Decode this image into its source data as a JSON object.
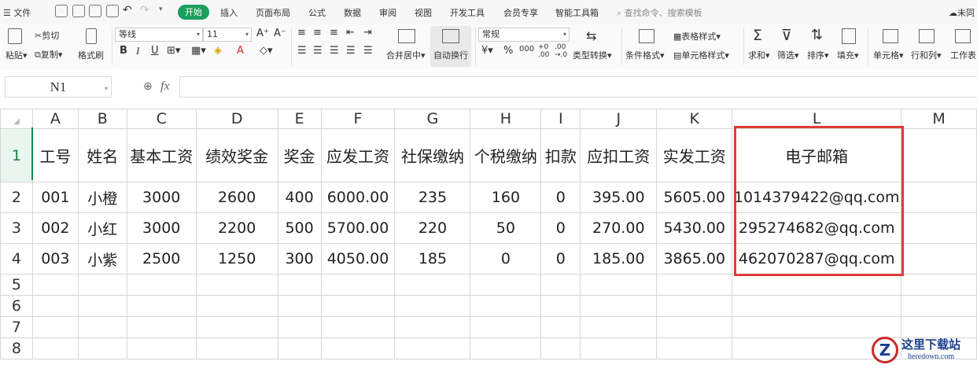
{
  "menu": {
    "file": "文件",
    "tabs": [
      "开始",
      "插入",
      "页面布局",
      "公式",
      "数据",
      "审阅",
      "视图",
      "开发工具",
      "会员专享",
      "智能工具箱"
    ],
    "search": "查找命令、搜索模板",
    "cloud": "未同"
  },
  "ribbon": {
    "paste": "粘贴",
    "cut": "剪切",
    "copy": "复制",
    "format_painter": "格式刷",
    "font_name": "等线",
    "font_size": "11",
    "merge_center": "合并居中",
    "wrap_text": "自动换行",
    "number_format": "常规",
    "type_convert": "类型转换",
    "conditional_format": "条件格式",
    "table_style": "表格样式",
    "cell_style": "单元格样式",
    "sum": "求和",
    "filter": "筛选",
    "sort": "排序",
    "fill": "填充",
    "cell": "单元格",
    "row_col": "行和列",
    "worksheet": "工作表"
  },
  "formula_bar": {
    "name_box": "N1",
    "fx": "fx",
    "value": ""
  },
  "sheet": {
    "columns": [
      "A",
      "B",
      "C",
      "D",
      "E",
      "F",
      "G",
      "H",
      "I",
      "J",
      "K",
      "L",
      "M"
    ],
    "rows": [
      "1",
      "2",
      "3",
      "4",
      "5",
      "6",
      "7",
      "8"
    ],
    "headers": [
      "工号",
      "姓名",
      "基本工资",
      "绩效奖金",
      "奖金",
      "应发工资",
      "社保缴纳",
      "个税缴纳",
      "扣款",
      "应扣工资",
      "实发工资",
      "电子邮箱"
    ],
    "data": [
      [
        "001",
        "小橙",
        "3000",
        "2600",
        "400",
        "6000.00",
        "235",
        "160",
        "0",
        "395.00",
        "5605.00",
        "1014379422@qq.com"
      ],
      [
        "002",
        "小红",
        "3000",
        "2200",
        "500",
        "5700.00",
        "220",
        "50",
        "0",
        "270.00",
        "5430.00",
        "295274682@qq.com"
      ],
      [
        "003",
        "小紫",
        "2500",
        "1250",
        "300",
        "4050.00",
        "185",
        "0",
        "0",
        "185.00",
        "3865.00",
        "462070287@qq.com"
      ]
    ]
  },
  "watermark": {
    "name": "这里下载站",
    "url": "heredown.com"
  },
  "colors": {
    "accent": "#1aa05c",
    "highlight": "#e03a3a"
  }
}
